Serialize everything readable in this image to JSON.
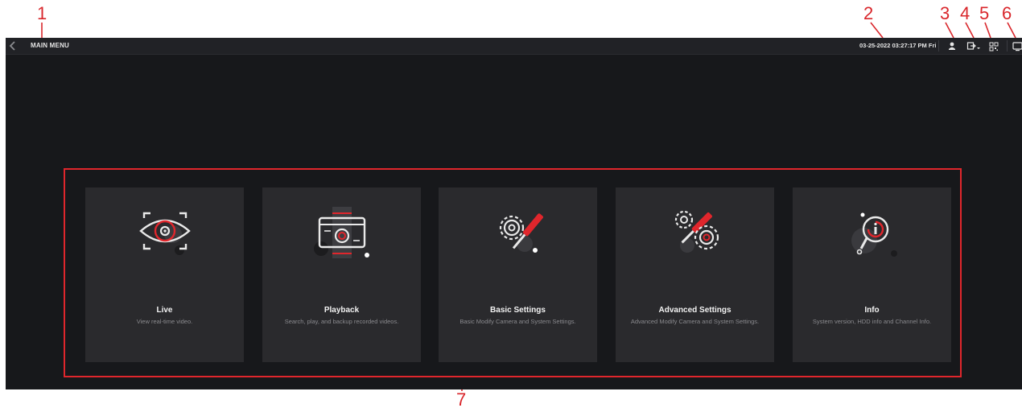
{
  "callouts": [
    "1",
    "2",
    "3",
    "4",
    "5",
    "6",
    "7"
  ],
  "topbar": {
    "title": "MAIN MENU",
    "datetime": "03-25-2022 03:27:17 PM Fri",
    "icons": [
      "back-arrow-icon",
      "user-icon",
      "logout-icon",
      "qr-code-icon",
      "fullscreen-icon"
    ]
  },
  "tiles": [
    {
      "title": "Live",
      "description": "View real-time video.",
      "icon": "eye-icon"
    },
    {
      "title": "Playback",
      "description": "Search, play, and backup recorded videos.",
      "icon": "playback-icon"
    },
    {
      "title": "Basic Settings",
      "description": "Basic Modify Camera and System Settings.",
      "icon": "gear-wrench-icon"
    },
    {
      "title": "Advanced Settings",
      "description": "Advanced Modify Camera and System Settings.",
      "icon": "gears-wrench-icon"
    },
    {
      "title": "Info",
      "description": "System version, HDD info and Channel Info.",
      "icon": "info-magnifier-icon"
    }
  ],
  "colors": {
    "accent": "#e0262c",
    "background": "#17181b",
    "topbar": "#212226",
    "tile": "#2a2a2d"
  }
}
